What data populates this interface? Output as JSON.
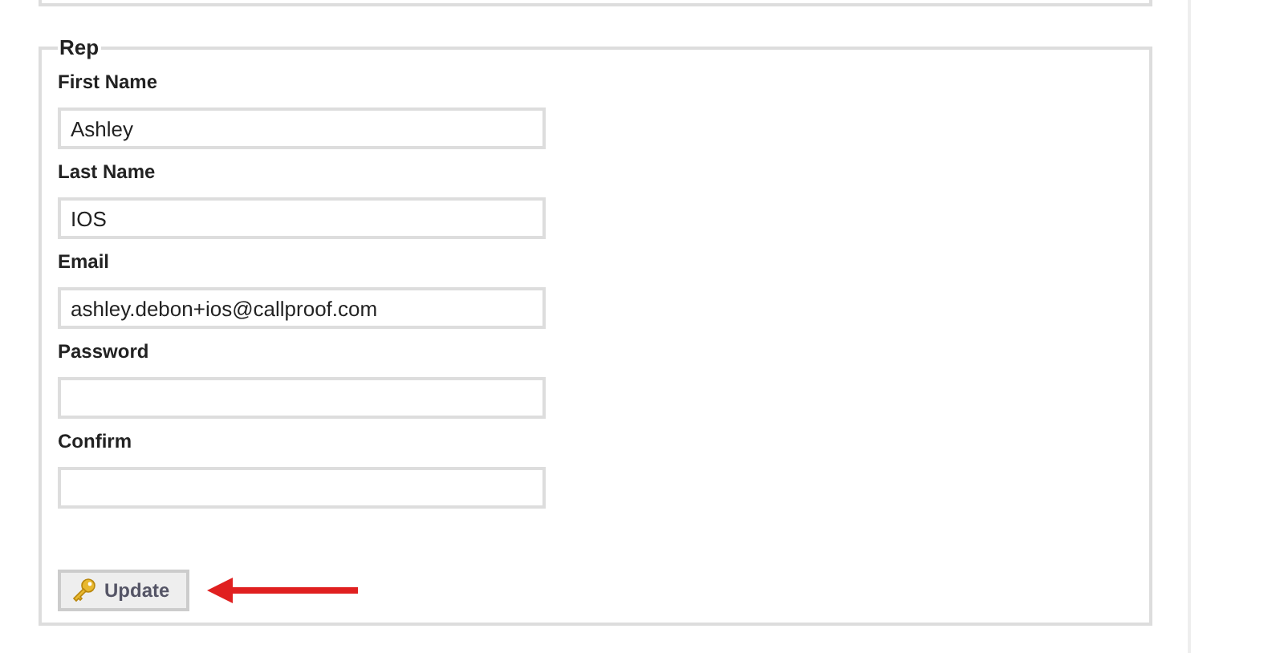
{
  "section": {
    "legend": "Rep"
  },
  "fields": [
    {
      "label": "First Name",
      "value": "Ashley"
    },
    {
      "label": "Last Name",
      "value": "IOS"
    },
    {
      "label": "Email",
      "value": "ashley.debon+ios@callproof.com"
    },
    {
      "label": "Password"
    },
    {
      "label": "Confirm"
    }
  ],
  "submit": {
    "label": "Update"
  }
}
